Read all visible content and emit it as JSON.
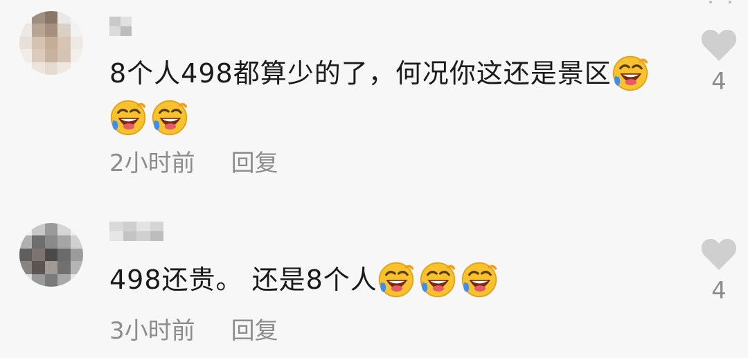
{
  "comments": [
    {
      "content": "8个人498都算少的了，何况你这还是景区",
      "emoji_count": 3,
      "time": "2小时前",
      "reply_label": "回复",
      "likes": "4"
    },
    {
      "content": "498还贵。 还是8个人",
      "emoji_count": 3,
      "time": "3小时前",
      "reply_label": "回复",
      "likes": "4"
    }
  ],
  "icons": {
    "like": "heart-icon",
    "emoji": "rolling-laughing-emoji"
  },
  "colors": {
    "background": "#f7f7f7",
    "text": "#1a1a1a",
    "meta": "#8c8c8c",
    "heart": "#cfcfcf",
    "emoji_face": "#f7c22e"
  }
}
